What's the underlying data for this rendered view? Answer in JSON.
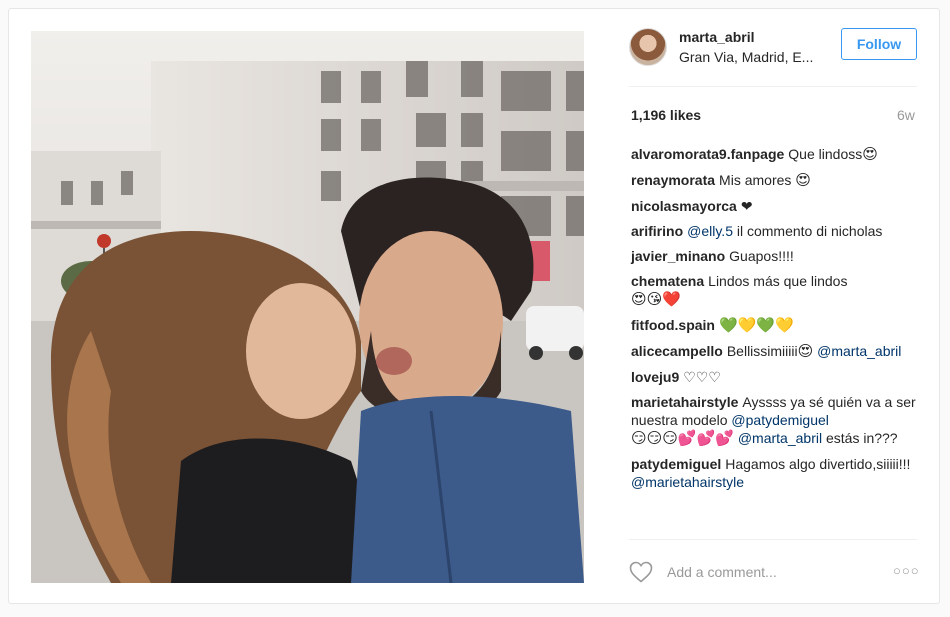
{
  "post": {
    "username": "marta_abril",
    "location": "Gran Via, Madrid, E...",
    "follow_label": "Follow",
    "likes": "1,196 likes",
    "age": "6w",
    "add_comment_placeholder": "Add a comment...",
    "more_options": "○○○"
  },
  "comments": [
    {
      "user": "alvaromorata9.fanpage",
      "text": "Que lindoss",
      "emoji": "😍"
    },
    {
      "user": "renaymorata",
      "text": "Mis amores ",
      "emoji": "😍"
    },
    {
      "user": "nicolasmayorca",
      "text": "❤"
    },
    {
      "user": "arifirino",
      "mention": "@elly.5",
      "text": " il commento di nicholas"
    },
    {
      "user": "javier_minano",
      "text": "Guapos!!!!"
    },
    {
      "user": "chematena",
      "text": "Lindos más que lindos",
      "emoji": "😍😘❤️"
    },
    {
      "user": "fitfood.spain",
      "emoji": "💚💛💚💛"
    },
    {
      "user": "alicecampello",
      "text": "Bellissimiiiii",
      "emoji": "😍",
      "mention": " @marta_abril"
    },
    {
      "user": "loveju9",
      "text": "♡♡♡"
    },
    {
      "user": "marietahairstyle",
      "text": "Ayssss ya sé quién va a ser nuestra modelo ",
      "mention": "@patydemiguel",
      "emoji": "😏😏😏💕💕💕",
      "mention2": "@marta_abril",
      "text2": " estás in???"
    },
    {
      "user": "patydemiguel",
      "text": "Hagamos algo divertido,siiiii!!! ",
      "mention": "@marietahairstyle"
    }
  ],
  "icons": {
    "heart": "heart-outline-icon",
    "avatar": "avatar"
  }
}
